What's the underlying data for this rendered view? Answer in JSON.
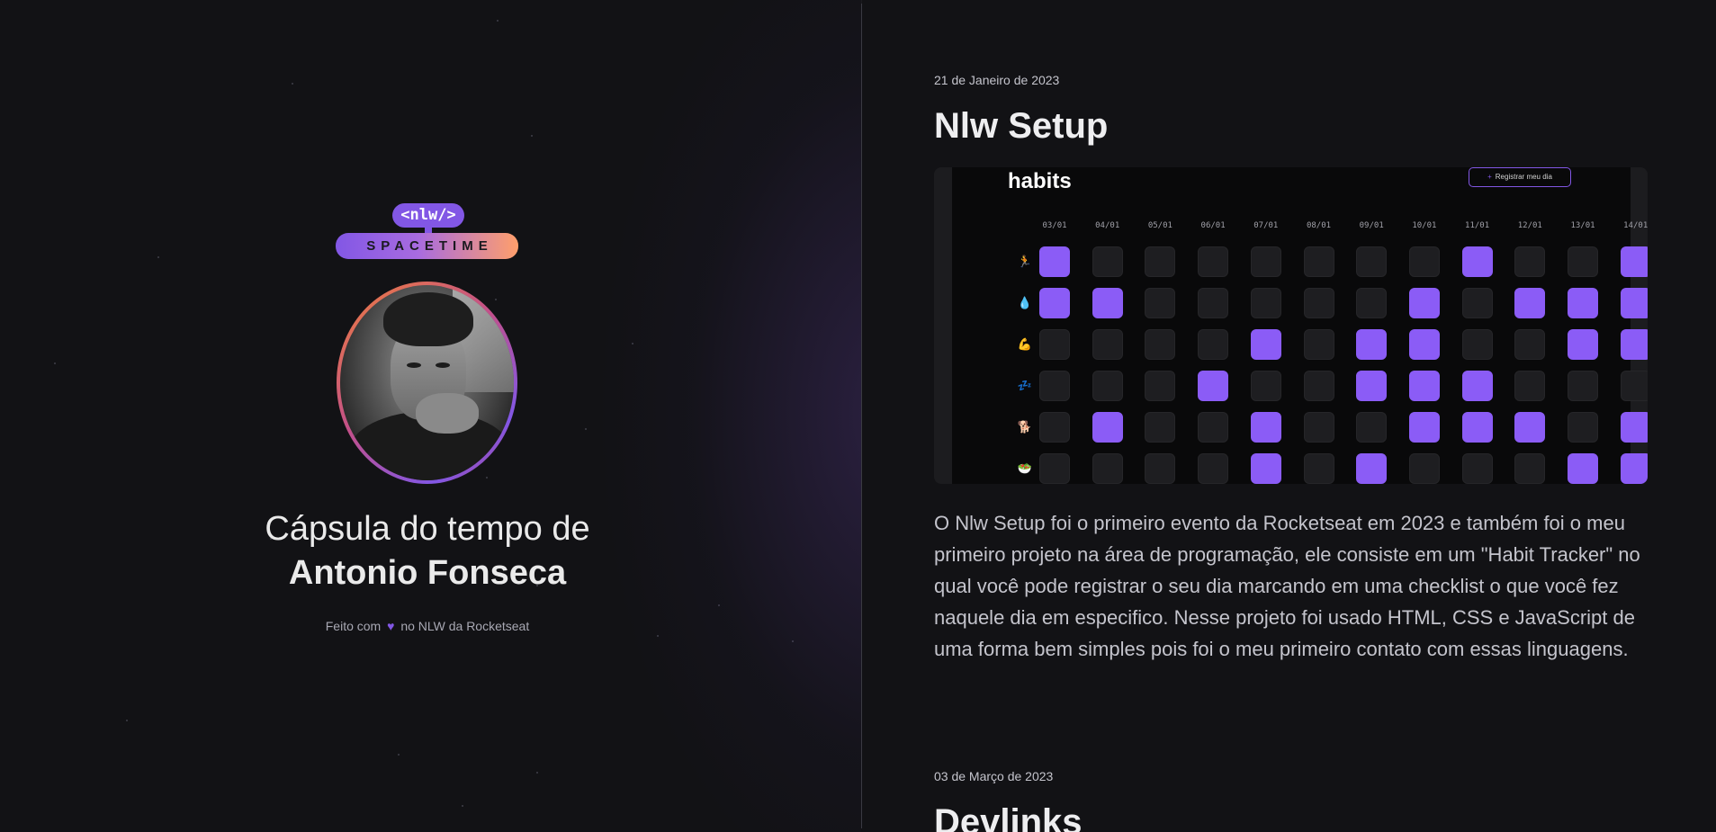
{
  "profile": {
    "logo_top": "<nlw/>",
    "logo_bottom": "SPACETIME",
    "title_line1": "Cápsula do tempo de",
    "title_line2": "Antonio Fonseca",
    "footer_prefix": "Feito com",
    "footer_icon": "heart-icon",
    "footer_suffix": "no NLW da Rocketseat"
  },
  "memories": [
    {
      "date": "21 de Janeiro de 2023",
      "title": "Nlw Setup",
      "description": "O Nlw Setup foi o primeiro evento da Rocketseat em 2023 e também foi o meu primeiro projeto na área de programação, ele consiste em um \"Habit Tracker\" no qual você pode registrar o seu dia marcando em uma checklist o que você fez naquele dia em especifico. Nesse projeto foi usado HTML, CSS e JavaScript de uma forma bem simples pois foi o meu primeiro contato com essas linguagens.",
      "screenshot": {
        "app_title": "habits",
        "button_label": "Registrar meu dia",
        "dates": [
          "03/01",
          "04/01",
          "05/01",
          "06/01",
          "07/01",
          "08/01",
          "09/01",
          "10/01",
          "11/01",
          "12/01",
          "13/01",
          "14/01"
        ],
        "habits": [
          "🏃",
          "💧",
          "💪",
          "💤",
          "🐕",
          "🥗"
        ],
        "grid": [
          [
            1,
            0,
            0,
            0,
            0,
            0,
            0,
            0,
            1,
            0,
            0,
            1
          ],
          [
            1,
            1,
            0,
            0,
            0,
            0,
            0,
            1,
            0,
            1,
            1,
            1
          ],
          [
            0,
            0,
            0,
            0,
            1,
            0,
            1,
            1,
            0,
            0,
            1,
            1
          ],
          [
            0,
            0,
            0,
            1,
            0,
            0,
            1,
            1,
            1,
            0,
            0,
            0
          ],
          [
            0,
            1,
            0,
            0,
            1,
            0,
            0,
            1,
            1,
            1,
            0,
            1
          ],
          [
            0,
            0,
            0,
            0,
            1,
            0,
            1,
            0,
            0,
            0,
            1,
            1
          ]
        ]
      }
    },
    {
      "date": "03 de Março de 2023",
      "title": "Devlinks"
    }
  ],
  "colors": {
    "accent": "#8257e5",
    "background": "#121215",
    "gradient_end": "#ff9f6b"
  }
}
